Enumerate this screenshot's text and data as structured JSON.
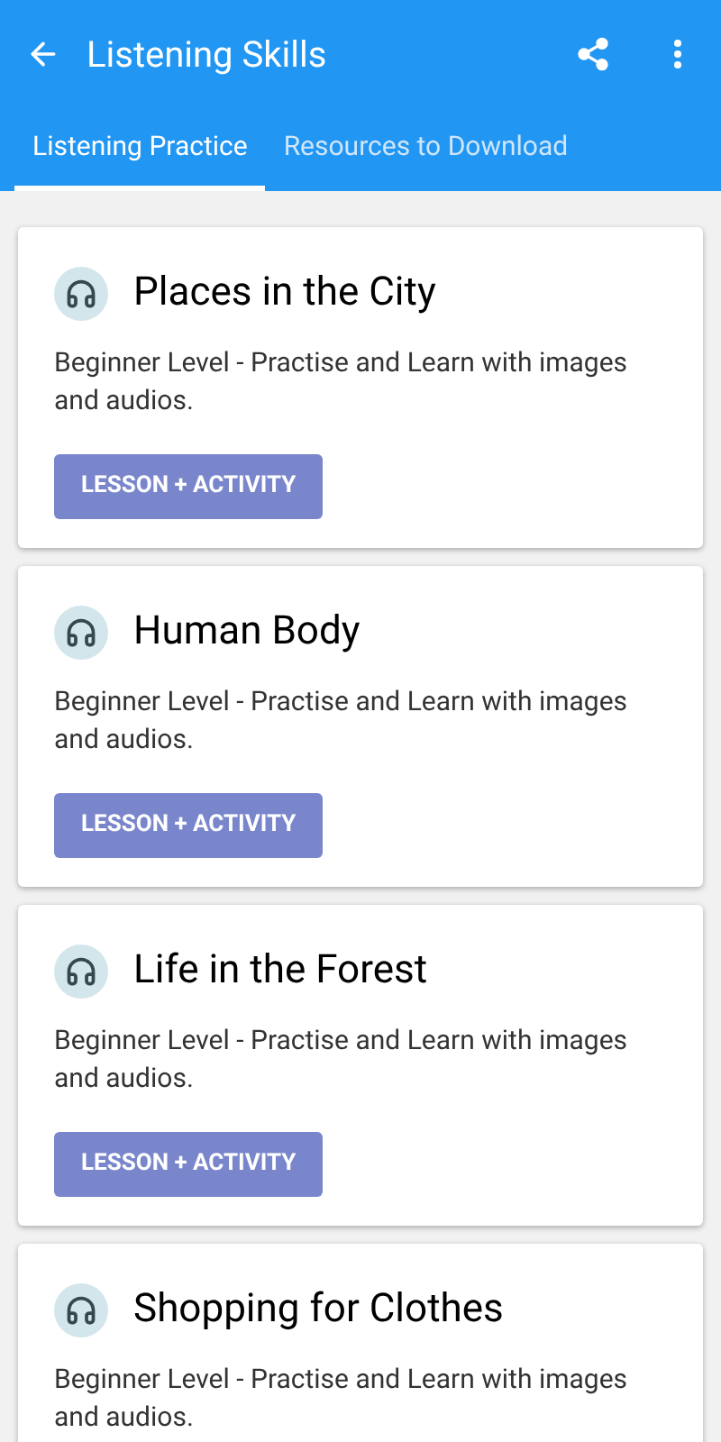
{
  "app_bar": {
    "title": "Listening Skills"
  },
  "tabs": [
    {
      "label": "Listening Practice",
      "selected": true
    },
    {
      "label": "Resources to Download",
      "selected": false
    }
  ],
  "lessons": [
    {
      "title": "Places in the City",
      "description": "Beginner Level - Practise and Learn with images and audios.",
      "button": "LESSON + ACTIVITY"
    },
    {
      "title": "Human Body",
      "description": "Beginner Level - Practise and Learn with images and audios.",
      "button": "LESSON + ACTIVITY"
    },
    {
      "title": "Life in the Forest",
      "description": "Beginner Level - Practise and Learn with images and audios.",
      "button": "LESSON + ACTIVITY"
    },
    {
      "title": "Shopping for Clothes",
      "description": "Beginner Level - Practise and Learn with images and audios."
    }
  ]
}
